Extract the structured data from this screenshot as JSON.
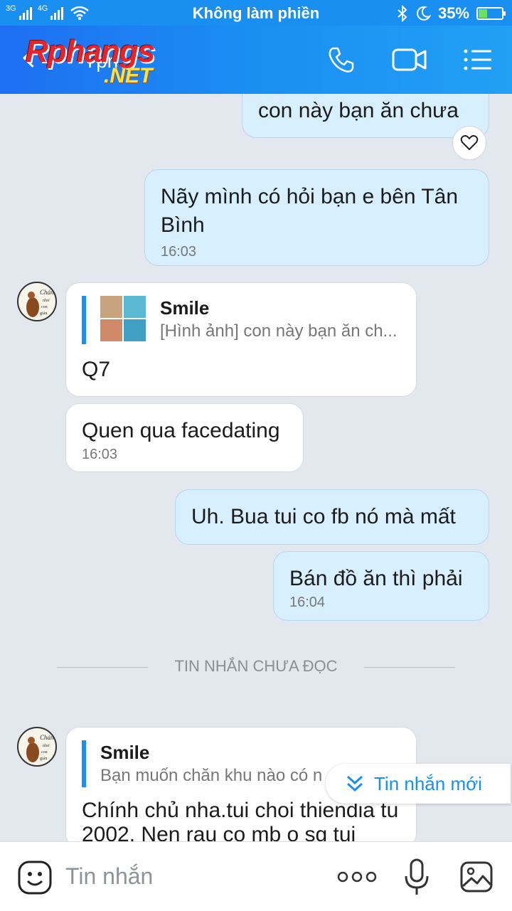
{
  "status_bar": {
    "network_1": "3G",
    "network_2": "4G",
    "dnd_text": "Không làm phiền",
    "battery": "35%",
    "battery_level": 0.35
  },
  "header": {
    "contact_name": "Tpn",
    "watermark_line1": "Rphangs",
    "watermark_line2": ".NET"
  },
  "messages": {
    "out_1_text": "con này bạn ăn chưa",
    "out_2_text": "Nãy mình có hỏi bạn e bên Tân Bình",
    "out_2_time": "16:03",
    "in_1_quote_name": "Smile",
    "in_1_quote_text": "[Hình ảnh] con này bạn ăn ch...",
    "in_1_text": "Q7",
    "in_2_text": "Quen qua facedating",
    "in_2_time": "16:03",
    "out_3_text": "Uh. Bua tui co fb nó mà mất",
    "out_4_text": "Bán đồ ăn thì phải",
    "out_4_time": "16:04",
    "unread_divider": "TIN NHẮN CHƯA ĐỌC",
    "in_3_quote_name": "Smile",
    "in_3_quote_text": "Bạn muốn chăn khu nào có n",
    "in_3_text": "Chính chủ nha.tui choi thiendia tu 2002. Nen rau co mb o sg tui"
  },
  "new_messages_pill": "Tin nhắn mới",
  "input": {
    "placeholder": "Tin nhắn"
  },
  "colors": {
    "header": "#1a8ff2",
    "outgoing_bubble": "#d7efff",
    "accent": "#1a8ff2"
  },
  "icons": [
    "back-arrow-icon",
    "phone-icon",
    "video-call-icon",
    "menu-list-icon",
    "heart-icon",
    "chevron-double-down-icon",
    "sticker-icon",
    "more-dots-icon",
    "microphone-icon",
    "image-icon"
  ]
}
